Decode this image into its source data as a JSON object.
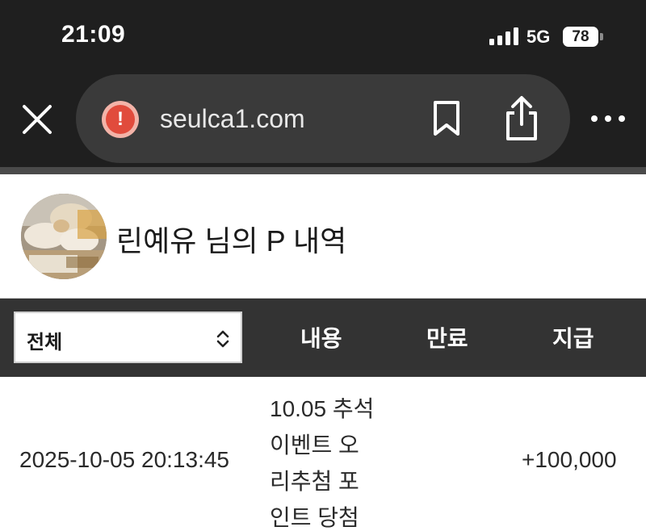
{
  "status_bar": {
    "time": "21:09",
    "network": "5G",
    "battery": "78"
  },
  "browser": {
    "url": "seulca1.com",
    "security_icon": "warning-icon",
    "close_icon": "close-icon",
    "bookmark_icon": "bookmark-icon",
    "share_icon": "share-icon",
    "more_icon": "more-icon"
  },
  "page": {
    "title": "린예유 님의 P 내역",
    "avatar": "profile-avatar"
  },
  "table": {
    "filter": {
      "selected": "전체"
    },
    "columns": [
      "내용",
      "만료",
      "지급"
    ],
    "rows": [
      {
        "date": "2025-10-05 20:13:45",
        "description_lines": [
          "10.05 추석",
          "이벤트 오",
          "리추첨 포",
          "인트 당첨"
        ],
        "expiry": "",
        "amount": "+100,000"
      }
    ]
  },
  "colors": {
    "chrome_bg": "#1f1f1f",
    "url_pill": "#3a3a3a",
    "warning": "#e14b3c",
    "table_header_bg": "#333333"
  }
}
